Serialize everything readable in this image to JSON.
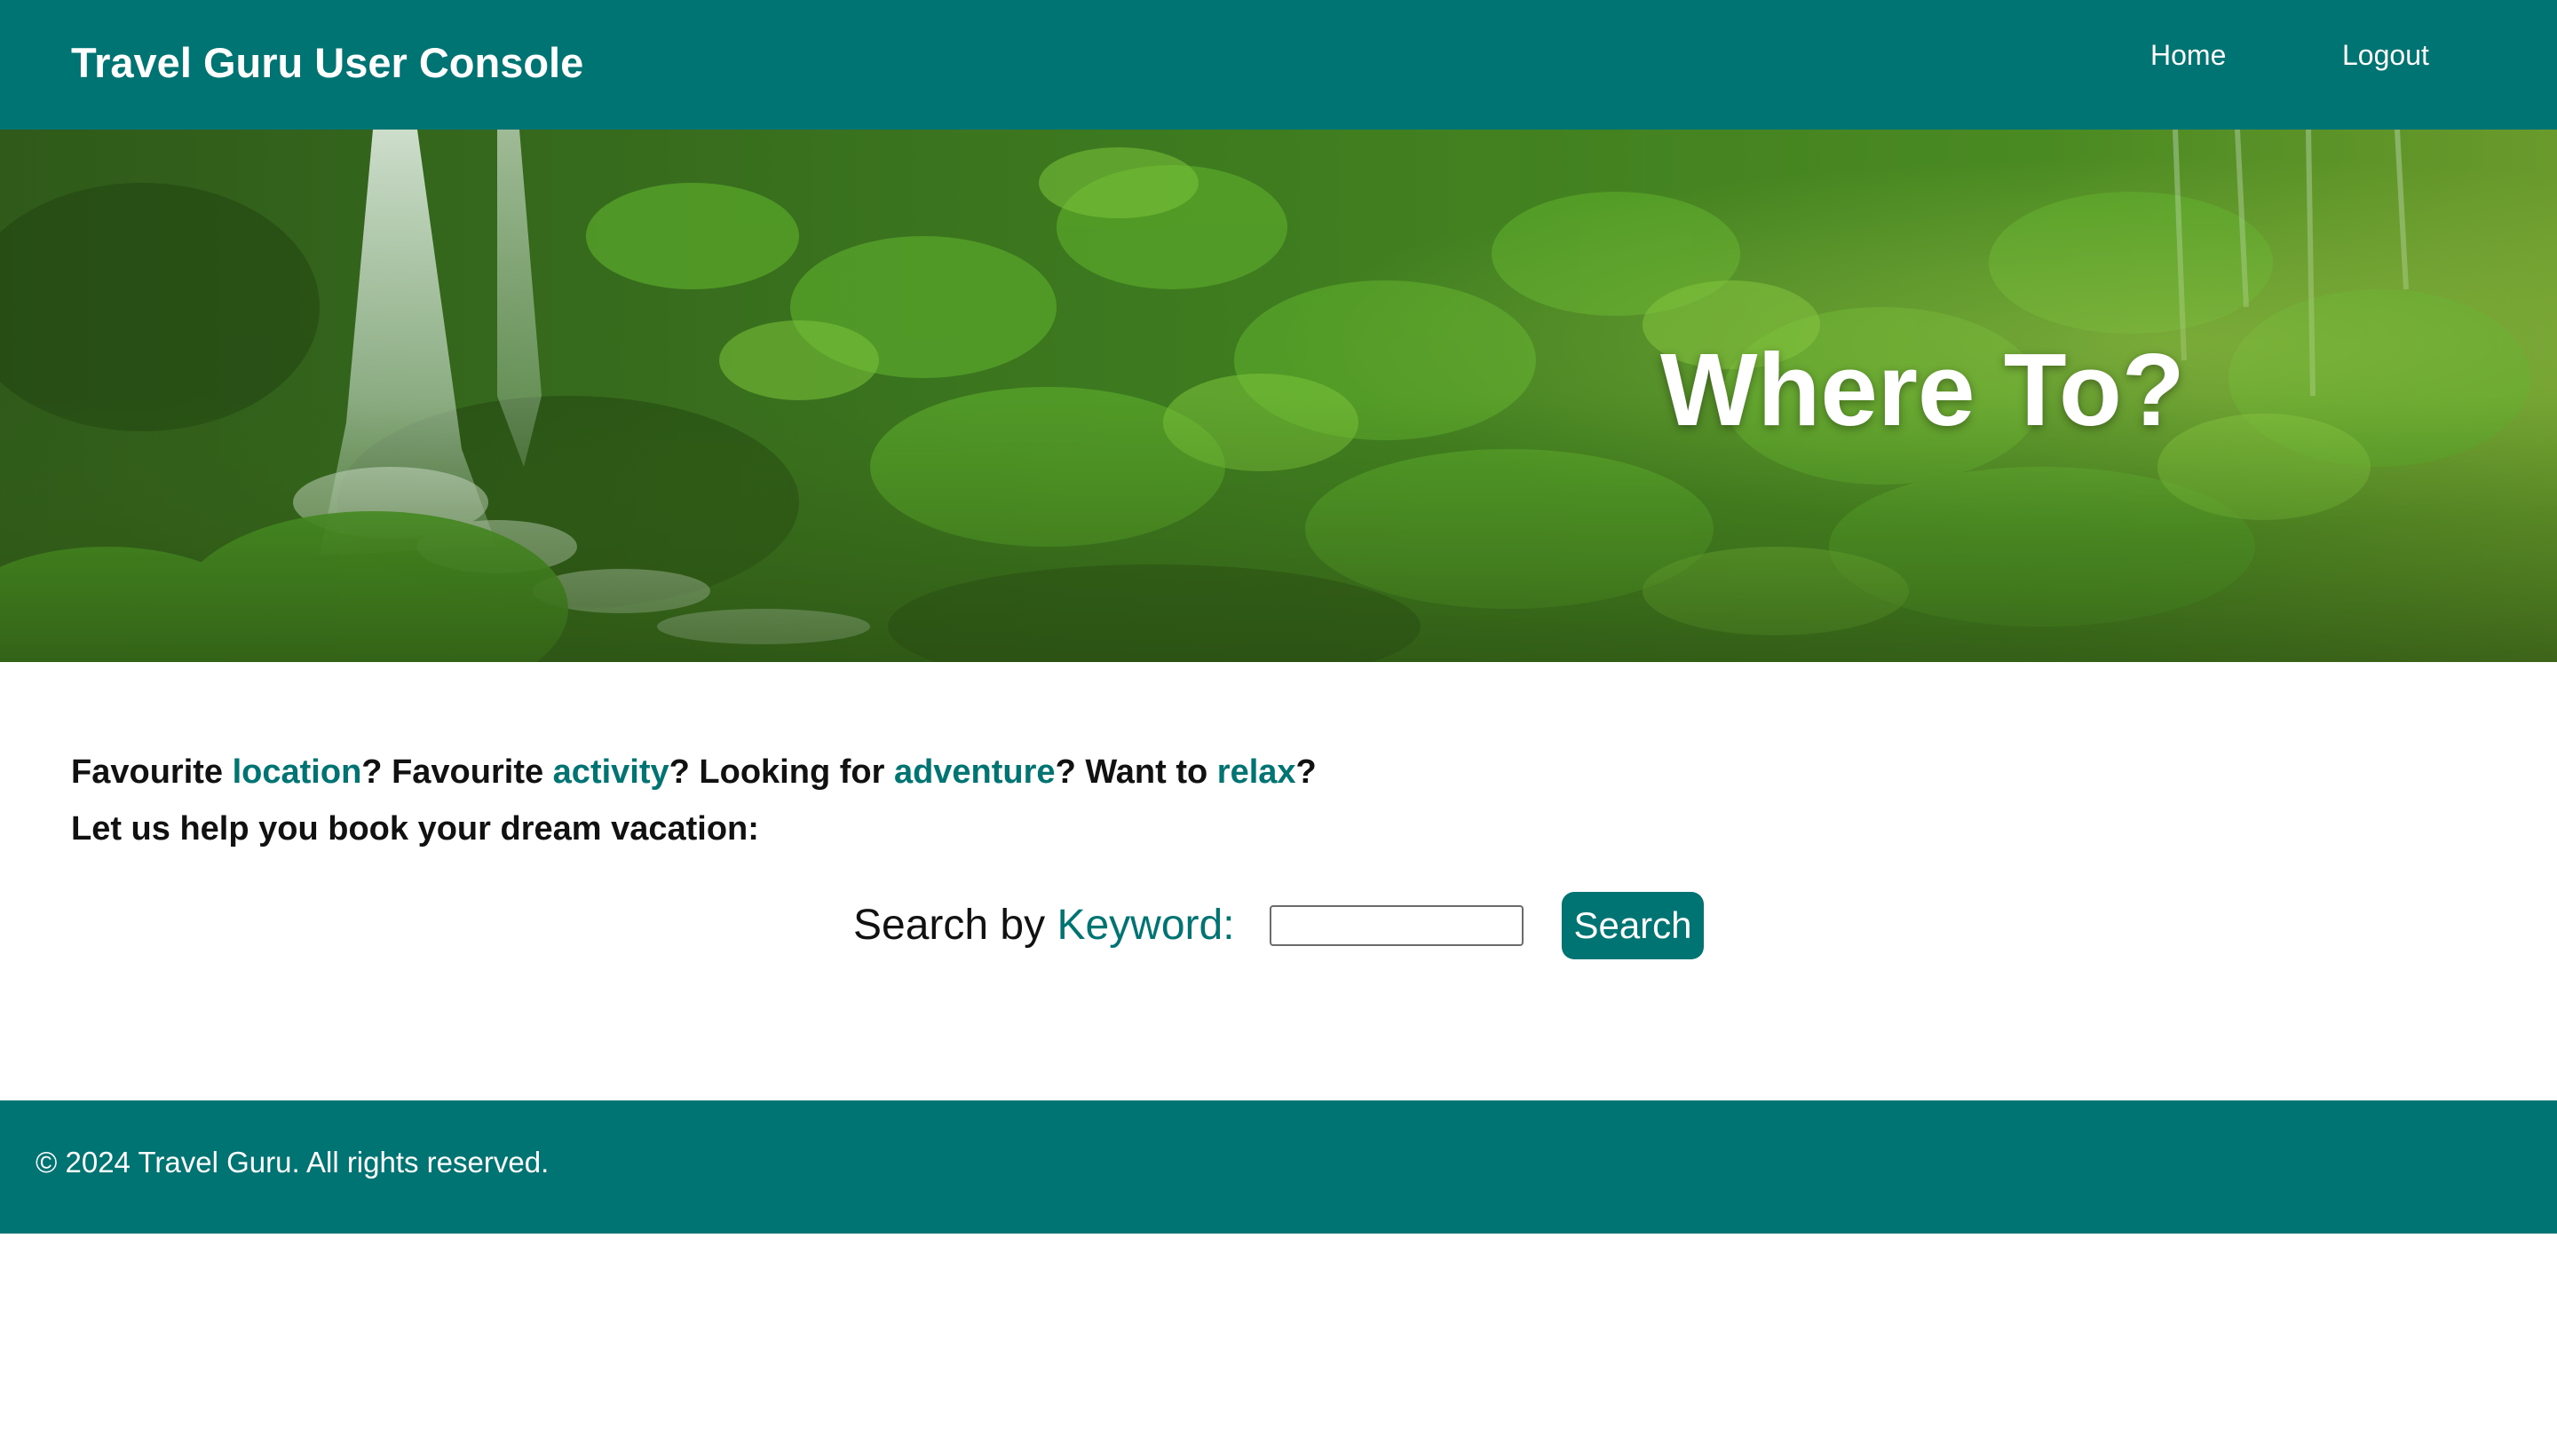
{
  "header": {
    "brand": "Travel Guru User Console",
    "nav": {
      "home": "Home",
      "logout": "Logout"
    },
    "background_color": "#007373"
  },
  "hero": {
    "title": "Where To?"
  },
  "intro": {
    "line1": {
      "p1": "Favourite ",
      "k1": "location",
      "p2": "? Favourite ",
      "k2": "activity",
      "p3": "? Looking for ",
      "k3": "adventure",
      "p4": "? Want to ",
      "k4": "relax",
      "p5": "?"
    },
    "line2": "Let us help you book your dream vacation:"
  },
  "search": {
    "label_prefix": "Search by ",
    "label_keyword": "Keyword:",
    "input_value": "",
    "button_label": "Search"
  },
  "footer": {
    "text": "© 2024 Travel Guru. All rights reserved."
  },
  "colors": {
    "accent": "#007373",
    "text": "#111111",
    "on_accent": "#ffffff"
  }
}
